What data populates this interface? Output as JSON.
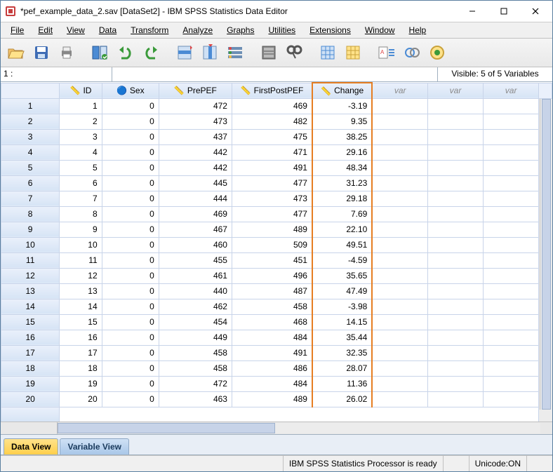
{
  "title": "*pef_example_data_2.sav [DataSet2] - IBM SPSS Statistics Data Editor",
  "menu": {
    "file": "File",
    "edit": "Edit",
    "view": "View",
    "data": "Data",
    "transform": "Transform",
    "analyze": "Analyze",
    "graphs": "Graphs",
    "utilities": "Utilities",
    "extensions": "Extensions",
    "window": "Window",
    "help": "Help"
  },
  "toolbar": {
    "open": "open",
    "save": "save",
    "print": "print",
    "recall": "recall",
    "undo": "undo",
    "redo": "redo",
    "goto_case": "goto-case",
    "goto_var": "goto-var",
    "variables": "variables",
    "run": "run",
    "find": "find",
    "insert_cases": "insert-cases",
    "insert_var": "insert-var",
    "split": "split",
    "weight": "weight",
    "select": "select",
    "value_labels": "value-labels"
  },
  "addrbar": {
    "cell_ref": "1 :",
    "cell_value": "",
    "visible": "Visible: 5 of 5 Variables"
  },
  "columns": {
    "id": "ID",
    "sex": "Sex",
    "prepef": "PrePEF",
    "firstpostpef": "FirstPostPEF",
    "change": "Change",
    "var": "var"
  },
  "rows": [
    {
      "n": 1,
      "id": 1,
      "sex": 0,
      "pre": 472,
      "post": 469,
      "chg": "-3.19"
    },
    {
      "n": 2,
      "id": 2,
      "sex": 0,
      "pre": 473,
      "post": 482,
      "chg": "9.35"
    },
    {
      "n": 3,
      "id": 3,
      "sex": 0,
      "pre": 437,
      "post": 475,
      "chg": "38.25"
    },
    {
      "n": 4,
      "id": 4,
      "sex": 0,
      "pre": 442,
      "post": 471,
      "chg": "29.16"
    },
    {
      "n": 5,
      "id": 5,
      "sex": 0,
      "pre": 442,
      "post": 491,
      "chg": "48.34"
    },
    {
      "n": 6,
      "id": 6,
      "sex": 0,
      "pre": 445,
      "post": 477,
      "chg": "31.23"
    },
    {
      "n": 7,
      "id": 7,
      "sex": 0,
      "pre": 444,
      "post": 473,
      "chg": "29.18"
    },
    {
      "n": 8,
      "id": 8,
      "sex": 0,
      "pre": 469,
      "post": 477,
      "chg": "7.69"
    },
    {
      "n": 9,
      "id": 9,
      "sex": 0,
      "pre": 467,
      "post": 489,
      "chg": "22.10"
    },
    {
      "n": 10,
      "id": 10,
      "sex": 0,
      "pre": 460,
      "post": 509,
      "chg": "49.51"
    },
    {
      "n": 11,
      "id": 11,
      "sex": 0,
      "pre": 455,
      "post": 451,
      "chg": "-4.59"
    },
    {
      "n": 12,
      "id": 12,
      "sex": 0,
      "pre": 461,
      "post": 496,
      "chg": "35.65"
    },
    {
      "n": 13,
      "id": 13,
      "sex": 0,
      "pre": 440,
      "post": 487,
      "chg": "47.49"
    },
    {
      "n": 14,
      "id": 14,
      "sex": 0,
      "pre": 462,
      "post": 458,
      "chg": "-3.98"
    },
    {
      "n": 15,
      "id": 15,
      "sex": 0,
      "pre": 454,
      "post": 468,
      "chg": "14.15"
    },
    {
      "n": 16,
      "id": 16,
      "sex": 0,
      "pre": 449,
      "post": 484,
      "chg": "35.44"
    },
    {
      "n": 17,
      "id": 17,
      "sex": 0,
      "pre": 458,
      "post": 491,
      "chg": "32.35"
    },
    {
      "n": 18,
      "id": 18,
      "sex": 0,
      "pre": 458,
      "post": 486,
      "chg": "28.07"
    },
    {
      "n": 19,
      "id": 19,
      "sex": 0,
      "pre": 472,
      "post": 484,
      "chg": "11.36"
    },
    {
      "n": 20,
      "id": 20,
      "sex": 0,
      "pre": 463,
      "post": 489,
      "chg": "26.02"
    }
  ],
  "tabs": {
    "data_view": "Data View",
    "variable_view": "Variable View"
  },
  "status": {
    "processor": "IBM SPSS Statistics Processor is ready",
    "unicode": "Unicode:ON"
  }
}
